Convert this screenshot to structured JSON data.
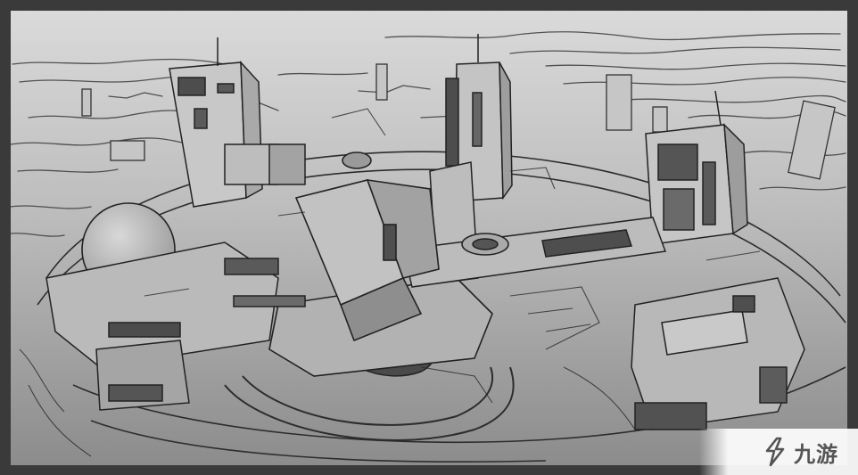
{
  "artwork": {
    "subject": "concept-sketch-scifi-city-base",
    "palette": {
      "frame": "#3a3a3a",
      "sky_top": "#d6d6d6",
      "ground_bottom": "#8d8d8d",
      "line": "#2b2b2b",
      "dark_fill": "#555555"
    }
  },
  "watermark": {
    "text": "九游",
    "icon": "jiuyou-logo-icon"
  }
}
